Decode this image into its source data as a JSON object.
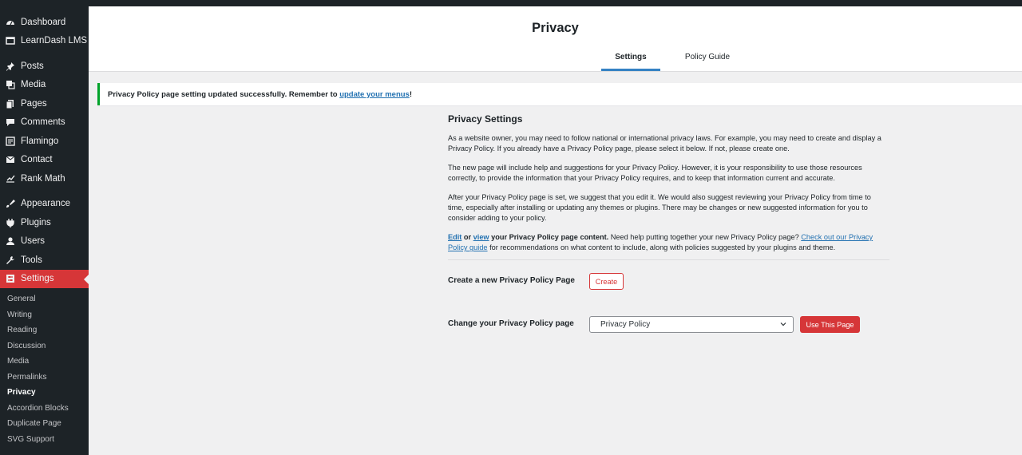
{
  "sidebar": {
    "items": [
      {
        "label": "Dashboard",
        "icon": "dashboard-icon"
      },
      {
        "label": "LearnDash LMS",
        "icon": "learndash-icon"
      },
      {
        "label": "Posts",
        "icon": "pin-icon"
      },
      {
        "label": "Media",
        "icon": "media-icon"
      },
      {
        "label": "Pages",
        "icon": "pages-icon"
      },
      {
        "label": "Comments",
        "icon": "comment-icon"
      },
      {
        "label": "Flamingo",
        "icon": "flamingo-icon"
      },
      {
        "label": "Contact",
        "icon": "mail-icon"
      },
      {
        "label": "Rank Math",
        "icon": "rank-math-icon"
      },
      {
        "label": "Appearance",
        "icon": "brush-icon"
      },
      {
        "label": "Plugins",
        "icon": "plug-icon"
      },
      {
        "label": "Users",
        "icon": "user-icon"
      },
      {
        "label": "Tools",
        "icon": "wrench-icon"
      },
      {
        "label": "Settings",
        "icon": "settings-icon"
      }
    ],
    "submenu": [
      "General",
      "Writing",
      "Reading",
      "Discussion",
      "Media",
      "Permalinks",
      "Privacy",
      "Accordion Blocks",
      "Duplicate Page",
      "SVG Support"
    ]
  },
  "header": {
    "title": "Privacy",
    "tabs": [
      "Settings",
      "Policy Guide"
    ]
  },
  "notice": {
    "text": "Privacy Policy page setting updated successfully. Remember to ",
    "link": "update your menus",
    "suffix": "!"
  },
  "main": {
    "heading": "Privacy Settings",
    "p1": "As a website owner, you may need to follow national or international privacy laws. For example, you may need to create and display a Privacy Policy. If you already have a Privacy Policy page, please select it below. If not, please create one.",
    "p2": "The new page will include help and suggestions for your Privacy Policy. However, it is your responsibility to use those resources correctly, to provide the information that your Privacy Policy requires, and to keep that information current and accurate.",
    "p3": "After your Privacy Policy page is set, we suggest that you edit it. We would also suggest reviewing your Privacy Policy from time to time, especially after installing or updating any themes or plugins. There may be changes or new suggested information for you to consider adding to your policy.",
    "p4": {
      "edit": "Edit",
      "or": " or ",
      "view": "view",
      "bold_rest": " your Privacy Policy page content.",
      "mid": " Need help putting together your new Privacy Policy page? ",
      "guide_link": "Check out our Privacy Policy guide",
      "end": " for recommendations on what content to include, along with policies suggested by your plugins and theme."
    },
    "create_label": "Create a new Privacy Policy Page",
    "create_button": "Create",
    "change_label": "Change your Privacy Policy page",
    "select_value": "Privacy Policy",
    "use_button": "Use This Page"
  },
  "colors": {
    "accent": "#d63638",
    "sidebar_bg": "#1d2327",
    "success": "#00a32a",
    "link": "#2271b1",
    "tab_active": "#3582c4"
  }
}
